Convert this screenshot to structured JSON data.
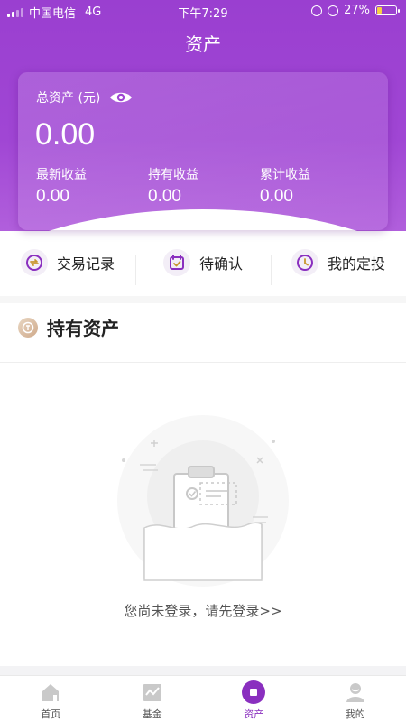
{
  "status_bar": {
    "carrier": "中国电信",
    "network": "4G",
    "time": "下午7:29",
    "battery": "27%",
    "battery_level": 0.27
  },
  "header": {
    "title": "资产"
  },
  "asset_card": {
    "total_label": "总资产 (元)",
    "total_value": "0.00",
    "metrics": [
      {
        "label": "最新收益",
        "value": "0.00"
      },
      {
        "label": "持有收益",
        "value": "0.00"
      },
      {
        "label": "累计收益",
        "value": "0.00"
      }
    ]
  },
  "shortcuts": [
    {
      "label": "交易记录",
      "icon": "exchange-icon"
    },
    {
      "label": "待确认",
      "icon": "calendar-check-icon"
    },
    {
      "label": "我的定投",
      "icon": "clock-icon"
    }
  ],
  "holdings": {
    "title": "持有资产",
    "empty_message": "您尚未登录，请先登录>>"
  },
  "tabbar": {
    "items": [
      {
        "label": "首页",
        "icon": "home-icon"
      },
      {
        "label": "基金",
        "icon": "chart-icon"
      },
      {
        "label": "资产",
        "icon": "asset-icon"
      },
      {
        "label": "我的",
        "icon": "user-icon"
      }
    ],
    "active_index": 2
  },
  "colors": {
    "brand_purple": "#9a3fd0",
    "active_tab": "#8a2fbf",
    "battery_fill": "#f5d142"
  }
}
